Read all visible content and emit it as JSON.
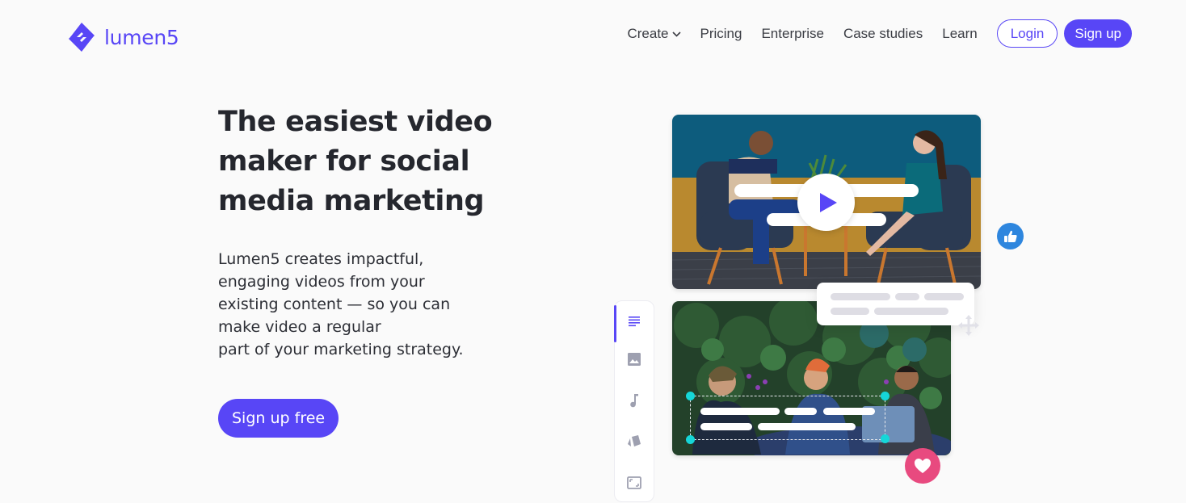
{
  "brand": {
    "name": "lumen5",
    "accent": "#5846f6",
    "logo_icon": "lumen5-diamond-logo-icon"
  },
  "nav": {
    "items": [
      {
        "label": "Create",
        "has_dropdown": true,
        "icon": "chevron-down-icon"
      },
      {
        "label": "Pricing"
      },
      {
        "label": "Enterprise"
      },
      {
        "label": "Case studies"
      },
      {
        "label": "Learn"
      }
    ],
    "login_label": "Login",
    "signup_label": "Sign up",
    "chevron": "⌄"
  },
  "hero": {
    "title_lines": [
      "The easiest video",
      "maker for social",
      "media marketing"
    ],
    "description_lines": [
      "Lumen5 creates impactful,",
      "engaging videos from your",
      "existing content — so you can",
      "make video a regular",
      "part of your marketing strategy."
    ],
    "cta_label": "Sign up free"
  },
  "illustration": {
    "video_card": {
      "icon": "play-icon",
      "scene": "two people seated in chairs"
    },
    "photo_card": {
      "scene": "three people at a table by an ivy wall"
    },
    "tool_panel": {
      "items": [
        {
          "name": "text-tool",
          "icon": "text-lines-icon",
          "active": true
        },
        {
          "name": "media-tool",
          "icon": "image-icon",
          "active": false
        },
        {
          "name": "music-tool",
          "icon": "music-note-icon",
          "active": false
        },
        {
          "name": "style-tool",
          "icon": "cards-icon",
          "active": false
        },
        {
          "name": "format-tool",
          "icon": "aspect-ratio-icon",
          "active": false
        }
      ]
    },
    "badges": {
      "like": {
        "icon": "thumbs-up-icon",
        "color": "#2e86de"
      },
      "heart": {
        "icon": "heart-icon",
        "color": "#e84a7f"
      }
    },
    "handle_color": "#16d6d8"
  }
}
